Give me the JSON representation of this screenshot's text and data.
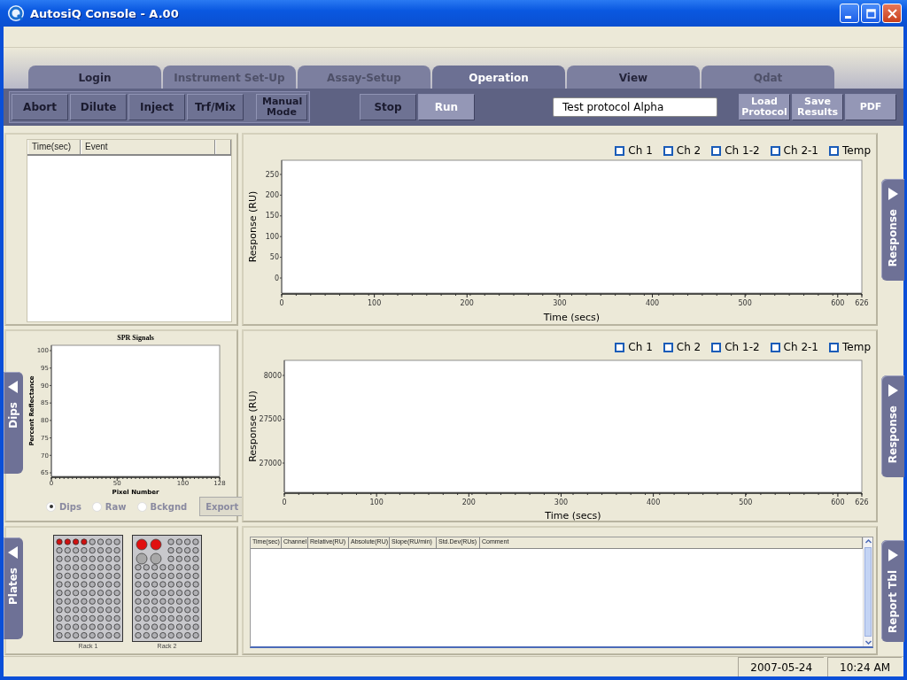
{
  "window": {
    "title": "AutosiQ Console - A.00"
  },
  "tabs": [
    {
      "label": "Login",
      "selected": false,
      "disabled": false
    },
    {
      "label": "Instrument Set-Up",
      "selected": false,
      "disabled": true
    },
    {
      "label": "Assay-Setup",
      "selected": false,
      "disabled": true
    },
    {
      "label": "Operation",
      "selected": true,
      "disabled": false
    },
    {
      "label": "View",
      "selected": false,
      "disabled": false
    },
    {
      "label": "Qdat",
      "selected": false,
      "disabled": true
    }
  ],
  "toolbar": {
    "left_buttons": [
      {
        "label": "Abort",
        "highlighted": false
      },
      {
        "label": "Dilute",
        "highlighted": false
      },
      {
        "label": "Inject",
        "highlighted": false
      },
      {
        "label": "Trf/Mix",
        "highlighted": false
      },
      {
        "label": "Manual Mode",
        "highlighted": false
      }
    ],
    "run_buttons": [
      {
        "label": "Stop",
        "highlighted": false
      },
      {
        "label": "Run",
        "highlighted": true
      }
    ],
    "protocol_field": {
      "value": "Test protocol Alpha"
    },
    "file_buttons": [
      {
        "label": "Load Protocol",
        "highlighted": true
      },
      {
        "label": "Save Results",
        "highlighted": true
      },
      {
        "label": "PDF",
        "highlighted": true
      }
    ]
  },
  "event_log": {
    "columns": [
      "Time(sec)",
      "Event"
    ]
  },
  "spr_panel": {
    "plot": {
      "title": "SPR Signals",
      "xlabel": "Pixel Number",
      "ylabel": "Percent Reflectance",
      "x_labels": [
        "0",
        "50",
        "100",
        "128"
      ],
      "y_labels": [
        "100",
        "95",
        "90",
        "85",
        "80",
        "75",
        "70",
        "65"
      ]
    },
    "radios": [
      {
        "label": "Dips",
        "selected": true
      },
      {
        "label": "Raw",
        "selected": false
      },
      {
        "label": "Bckgnd",
        "selected": false
      }
    ],
    "export_button": {
      "label": "Export",
      "disabled": true
    }
  },
  "response_panels": [
    {
      "channels": [
        {
          "label": "Ch 1",
          "checked": false
        },
        {
          "label": "Ch 2",
          "checked": false
        },
        {
          "label": "Ch 1-2",
          "checked": false
        },
        {
          "label": "Ch 2-1",
          "checked": false
        },
        {
          "label": "Temp",
          "checked": false
        }
      ],
      "plot": {
        "xlabel": "Time (secs)",
        "ylabel": "Response (RU)",
        "x_labels": [
          "0",
          "100",
          "200",
          "300",
          "400",
          "500",
          "600",
          "626"
        ],
        "y_labels": [
          "250",
          "200",
          "150",
          "100",
          "50",
          "0"
        ]
      }
    },
    {
      "channels": [
        {
          "label": "Ch 1",
          "checked": false
        },
        {
          "label": "Ch 2",
          "checked": false
        },
        {
          "label": "Ch 1-2",
          "checked": false
        },
        {
          "label": "Ch 2-1",
          "checked": false
        },
        {
          "label": "Temp",
          "checked": false
        }
      ],
      "plot": {
        "xlabel": "Time (secs)",
        "ylabel": "Response (RU)",
        "x_labels": [
          "0",
          "100",
          "200",
          "300",
          "400",
          "500",
          "600",
          "626"
        ],
        "y_labels": [
          "8000",
          "27500",
          "27000"
        ]
      }
    }
  ],
  "racks": [
    {
      "label": "Rack 1",
      "kind": "plate",
      "wells": [
        [
          true,
          true,
          true,
          true,
          false,
          false,
          false,
          false
        ],
        [
          false,
          false,
          false,
          false,
          false,
          false,
          false,
          false
        ],
        [
          false,
          false,
          false,
          false,
          false,
          false,
          false,
          false
        ],
        [
          false,
          false,
          false,
          false,
          false,
          false,
          false,
          false
        ],
        [
          false,
          false,
          false,
          false,
          false,
          false,
          false,
          false
        ],
        [
          false,
          false,
          false,
          false,
          false,
          false,
          false,
          false
        ],
        [
          false,
          false,
          false,
          false,
          false,
          false,
          false,
          false
        ],
        [
          false,
          false,
          false,
          false,
          false,
          false,
          false,
          false
        ],
        [
          false,
          false,
          false,
          false,
          false,
          false,
          false,
          false
        ],
        [
          false,
          false,
          false,
          false,
          false,
          false,
          false,
          false
        ],
        [
          false,
          false,
          false,
          false,
          false,
          false,
          false,
          false
        ],
        [
          false,
          false,
          false,
          false,
          false,
          false,
          false,
          false
        ]
      ]
    },
    {
      "label": "Rack 2",
      "kind": "vials",
      "vials": [
        {
          "filled": true
        },
        {
          "filled": true
        },
        {
          "filled": false
        },
        {
          "filled": false
        }
      ],
      "wells": [
        [
          false,
          false,
          false,
          false
        ],
        [
          false,
          false,
          false,
          false
        ],
        [
          false,
          false,
          false,
          false
        ],
        [
          false,
          false,
          false,
          false,
          false,
          false,
          false,
          false
        ],
        [
          false,
          false,
          false,
          false,
          false,
          false,
          false,
          false
        ],
        [
          false,
          false,
          false,
          false,
          false,
          false,
          false,
          false
        ],
        [
          false,
          false,
          false,
          false,
          false,
          false,
          false,
          false
        ],
        [
          false,
          false,
          false,
          false,
          false,
          false,
          false,
          false
        ],
        [
          false,
          false,
          false,
          false,
          false,
          false,
          false,
          false
        ],
        [
          false,
          false,
          false,
          false,
          false,
          false,
          false,
          false
        ],
        [
          false,
          false,
          false,
          false,
          false,
          false,
          false,
          false
        ],
        [
          false,
          false,
          false,
          false,
          false,
          false,
          false,
          false
        ]
      ]
    }
  ],
  "report_table": {
    "columns": [
      "Time(sec)",
      "Channel",
      "Relative(RU)",
      "Absolute(RU)",
      "Slope(RU/min)",
      "Std.Dev(RUs)",
      "Comment"
    ]
  },
  "left_side_tabs": [
    {
      "label": "Dips"
    },
    {
      "label": "Plates"
    }
  ],
  "right_side_tabs": [
    {
      "label": "Response"
    },
    {
      "label": "Response"
    },
    {
      "label": "Report Tbl"
    }
  ],
  "status_bar": [
    "2007-05-24",
    "10:24 AM"
  ]
}
